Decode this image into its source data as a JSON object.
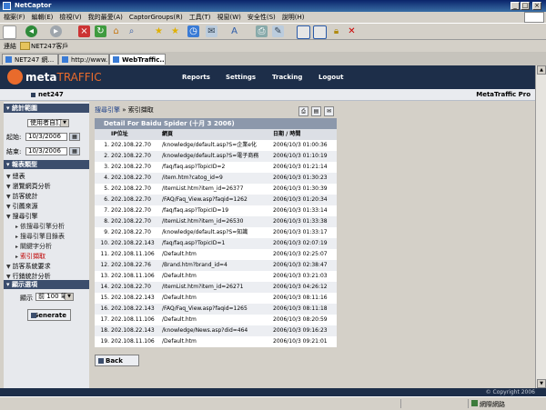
{
  "window": {
    "title": "NetCaptor"
  },
  "menu": [
    "檔案(F)",
    "編輯(E)",
    "檢視(V)",
    "我的最愛(A)",
    "CaptorGroups(R)",
    "工具(T)",
    "視窗(W)",
    "安全性(S)",
    "說明(H)"
  ],
  "address": {
    "label": "連結",
    "value": "NET247客戶"
  },
  "tabs": [
    {
      "label": "NET247 網..."
    },
    {
      "label": "http://www..."
    },
    {
      "label": "WebTraffic..."
    }
  ],
  "header": {
    "logo_main": "meta",
    "logo_accent": "TRAFFIC",
    "nav": [
      "Reports",
      "Settings",
      "Tracking",
      "Logout"
    ]
  },
  "subheader": {
    "account": "net247",
    "product": "MetaTraffic Pro"
  },
  "sidebar": {
    "section_range": "統計範圍",
    "range_select": "使用者自訂",
    "start_label": "起始:",
    "start_value": "10/3/2006",
    "end_label": "結束:",
    "end_value": "10/3/2006",
    "section_report": "報表類型",
    "nav": [
      {
        "label": "總表"
      },
      {
        "label": "瀏覽網頁分析"
      },
      {
        "label": "訪客統計"
      },
      {
        "label": "引薦來源"
      },
      {
        "label": "搜尋引擎"
      },
      {
        "label": "依搜尋引擎分析"
      },
      {
        "label": "搜尋引擎目錄表"
      },
      {
        "label": "關鍵字分析"
      },
      {
        "label": "索引擷取"
      },
      {
        "label": "訪客系統要求"
      },
      {
        "label": "行銷統計分析"
      }
    ],
    "section_display": "顯示選項",
    "show_label": "顯示",
    "show_value": "前 100 筆",
    "generate": "Generate"
  },
  "main": {
    "crumb_link": "搜尋引擎",
    "crumb_sep": "»",
    "crumb_current": "索引擷取",
    "table_title": "Detail For Baidu Spider (十月 3 2006)",
    "col_ip": "IP位址",
    "col_page": "網頁",
    "col_date": "日期 / 時間",
    "rows": [
      {
        "n": "1.",
        "ip": "202.108.22.70",
        "page": "/knowledge/default.asp?S=企業e化",
        "date": "2006/10/3 01:00:36"
      },
      {
        "n": "2.",
        "ip": "202.108.22.70",
        "page": "/knowledge/default.asp?S=電子商務",
        "date": "2006/10/3 01:10:19"
      },
      {
        "n": "3.",
        "ip": "202.108.22.70",
        "page": "/faq/faq.asp?TopicID=2",
        "date": "2006/10/3 01:21:14"
      },
      {
        "n": "4.",
        "ip": "202.108.22.70",
        "page": "/item.htm?catog_id=9",
        "date": "2006/10/3 01:30:23"
      },
      {
        "n": "5.",
        "ip": "202.108.22.70",
        "page": "/ItemList.htm?item_id=26377",
        "date": "2006/10/3 01:30:39"
      },
      {
        "n": "6.",
        "ip": "202.108.22.70",
        "page": "/FAQ/Faq_View.asp?faqid=1262",
        "date": "2006/10/3 01:20:34"
      },
      {
        "n": "7.",
        "ip": "202.108.22.70",
        "page": "/faq/faq.asp?TopicID=19",
        "date": "2006/10/3 01:33:14"
      },
      {
        "n": "8.",
        "ip": "202.108.22.70",
        "page": "/ItemList.htm?item_id=26530",
        "date": "2006/10/3 01:33:38"
      },
      {
        "n": "9.",
        "ip": "202.108.22.70",
        "page": "/knowledge/default.asp?S=知識",
        "date": "2006/10/3 01:33:17"
      },
      {
        "n": "10.",
        "ip": "202.108.22.143",
        "page": "/faq/faq.asp?TopicID=1",
        "date": "2006/10/3 02:07:19"
      },
      {
        "n": "11.",
        "ip": "202.108.11.106",
        "page": "/Default.htm",
        "date": "2006/10/3 02:25:07"
      },
      {
        "n": "12.",
        "ip": "202.108.22.76",
        "page": "/Brand.htm?brand_id=4",
        "date": "2006/10/3 02:38:47"
      },
      {
        "n": "13.",
        "ip": "202.108.11.106",
        "page": "/Default.htm",
        "date": "2006/10/3 03:21:03"
      },
      {
        "n": "14.",
        "ip": "202.108.22.70",
        "page": "/ItemList.htm?item_id=26271",
        "date": "2006/10/3 04:26:12"
      },
      {
        "n": "15.",
        "ip": "202.108.22.143",
        "page": "/Default.htm",
        "date": "2006/10/3 08:11:16"
      },
      {
        "n": "16.",
        "ip": "202.108.22.143",
        "page": "/FAQ/Faq_View.asp?faqid=1265",
        "date": "2006/10/3 08:11:18"
      },
      {
        "n": "17.",
        "ip": "202.108.11.106",
        "page": "/Default.htm",
        "date": "2006/10/3 08:20:59"
      },
      {
        "n": "18.",
        "ip": "202.108.22.143",
        "page": "/knowledge/News.asp?did=464",
        "date": "2006/10/3 09:16:23"
      },
      {
        "n": "19.",
        "ip": "202.108.11.106",
        "page": "/Default.htm",
        "date": "2006/10/3 09:21:01"
      }
    ],
    "back": "Back"
  },
  "footer": {
    "copyright": "© Copyright 2006"
  },
  "status": {
    "zone": "網際網路"
  }
}
